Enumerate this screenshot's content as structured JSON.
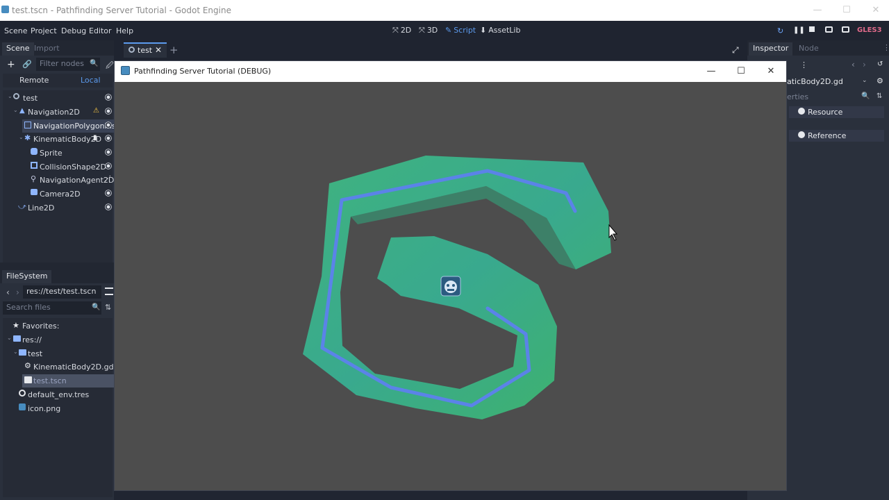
{
  "os_window": {
    "title": "test.tscn - Pathfinding Server Tutorial - Godot Engine",
    "minimize": "—",
    "maximize": "☐",
    "close": "✕"
  },
  "menu": {
    "items": [
      "Scene",
      "Project",
      "Debug",
      "Editor",
      "Help"
    ],
    "workspaces": [
      {
        "label": "2D",
        "icon": "2d-icon"
      },
      {
        "label": "3D",
        "icon": "3d-icon"
      },
      {
        "label": "Script",
        "icon": "script-icon"
      },
      {
        "label": "AssetLib",
        "icon": "assetlib-icon"
      }
    ],
    "renderer": "GLES3"
  },
  "scene_dock": {
    "tabs": [
      "Scene",
      "Import"
    ],
    "filter_placeholder": "Filter nodes",
    "remote_label": "Remote",
    "local_label": "Local",
    "tree": [
      {
        "label": "test",
        "icon": "node2d-icon"
      },
      {
        "label": "Navigation2D",
        "icon": "navigation-icon"
      },
      {
        "label": "NavigationPolygonIns",
        "icon": "navpolygon-icon"
      },
      {
        "label": "KinematicBody2D",
        "icon": "kinematic-icon"
      },
      {
        "label": "Sprite",
        "icon": "sprite-icon"
      },
      {
        "label": "CollisionShape2D",
        "icon": "collision-icon"
      },
      {
        "label": "NavigationAgent2D",
        "icon": "navagent-icon"
      },
      {
        "label": "Camera2D",
        "icon": "camera-icon"
      },
      {
        "label": "Line2D",
        "icon": "line2d-icon"
      }
    ]
  },
  "filesystem_dock": {
    "tab": "FileSystem",
    "path": "res://test/test.tscn",
    "search_placeholder": "Search files",
    "items": [
      {
        "label": "Favorites:",
        "icon": "star-icon"
      },
      {
        "label": "res://",
        "icon": "folder-icon"
      },
      {
        "label": "test",
        "icon": "folder-icon"
      },
      {
        "label": "KinematicBody2D.gd",
        "icon": "gear-icon"
      },
      {
        "label": "test.tscn",
        "icon": "scene-file-icon"
      },
      {
        "label": "default_env.tres",
        "icon": "env-icon"
      },
      {
        "label": "icon.png",
        "icon": "image-icon"
      }
    ]
  },
  "editor_tabs": {
    "open_tab": "test",
    "add": "+"
  },
  "inspector": {
    "tabs": [
      "Inspector",
      "Node"
    ],
    "object": "aticBody2D.gd",
    "filter_placeholder": "erties",
    "buttons": [
      "Resource",
      "Reference"
    ]
  },
  "game_window": {
    "title": "Pathfinding Server Tutorial (DEBUG)",
    "minimize": "—",
    "maximize": "☐",
    "close": "✕"
  },
  "colors": {
    "navmesh": "#3fb37f",
    "path": "#5b83e8",
    "background": "#4d4d4d",
    "accent": "#478cbf"
  }
}
